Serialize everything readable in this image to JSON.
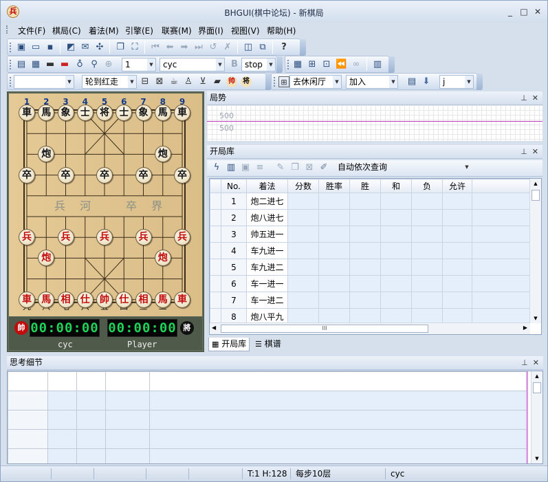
{
  "window": {
    "title": "BHGUI(棋中论坛) - 新棋局",
    "app_icon": "兵",
    "controls": [
      "_",
      "□",
      "✕"
    ]
  },
  "menu": [
    "文件(F)",
    "棋局(C)",
    "着法(M)",
    "引擎(E)",
    "联赛(M)",
    "界面(I)",
    "视图(V)",
    "帮助(H)"
  ],
  "toolbar2": {
    "count": "1",
    "engine": "cyc",
    "bold": "B",
    "stop": "stop"
  },
  "toolbar3": {
    "combo_empty": "",
    "turn": "轮到红走",
    "venue": "去休闲厅",
    "action": "加入",
    "small": "j"
  },
  "board": {
    "top_numbers": [
      "1",
      "2",
      "3",
      "4",
      "5",
      "6",
      "7",
      "8",
      "9"
    ],
    "bottom_numbers": [
      "九",
      "八",
      "七",
      "六",
      "五",
      "四",
      "三",
      "二",
      "一"
    ],
    "river_left": "兵 河",
    "river_right": "卒 界",
    "black_back": [
      "車",
      "馬",
      "象",
      "士",
      "将",
      "士",
      "象",
      "馬",
      "車"
    ],
    "black_cannon": "炮",
    "black_pawn": "卒",
    "red_back": [
      "車",
      "馬",
      "相",
      "仕",
      "帥",
      "仕",
      "相",
      "馬",
      "車"
    ],
    "red_cannon": "炮",
    "red_pawn": "兵"
  },
  "clocks": {
    "red_gen": "帥",
    "black_gen": "將",
    "red_time": "00:00:00",
    "black_time": "00:00:00",
    "red_player": "cyc",
    "black_player": "Player"
  },
  "trend": {
    "title": "局势",
    "val1": "500",
    "val2": "500"
  },
  "book": {
    "title": "开局库",
    "query_mode": "自动依次查询",
    "headers": [
      "No.",
      "着法",
      "分数",
      "胜率",
      "胜",
      "和",
      "负",
      "允许"
    ],
    "rows": [
      [
        "1",
        "炮二进七"
      ],
      [
        "2",
        "炮八进七"
      ],
      [
        "3",
        "帅五进一"
      ],
      [
        "4",
        "车九进一"
      ],
      [
        "5",
        "车九进二"
      ],
      [
        "6",
        "车一进一"
      ],
      [
        "7",
        "车一进二"
      ],
      [
        "8",
        "炮八平九"
      ]
    ],
    "scroll_grip": "III"
  },
  "tabs": [
    "开局库",
    "棋谱"
  ],
  "think": {
    "title": "思考细节"
  },
  "status": {
    "th": "T:1 H:128",
    "depth": "每步10层",
    "engine": "cyc"
  },
  "colors": {
    "accent": "#c03cc0",
    "clock_digits": "#1fd35a",
    "board": "#e3c58d"
  }
}
